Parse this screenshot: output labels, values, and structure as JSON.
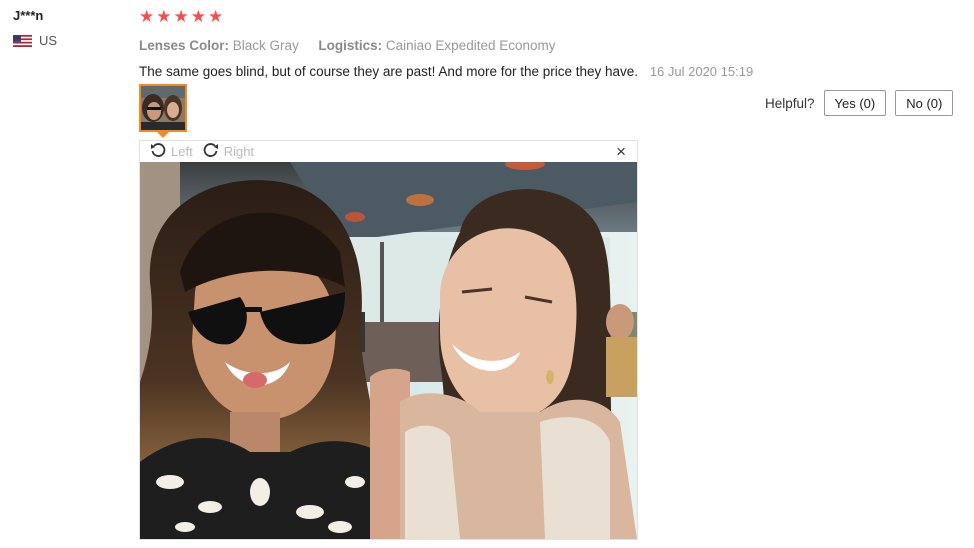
{
  "user": {
    "name": "J***n",
    "country": "US",
    "flag_icon": "us-flag-icon"
  },
  "review": {
    "rating": 5,
    "stars": [
      "★",
      "★",
      "★",
      "★",
      "★"
    ],
    "star_color": "#f44f4f",
    "attributes": [
      {
        "label": "Lenses Color:",
        "value": "Black Gray"
      },
      {
        "label": "Logistics:",
        "value": "Cainiao Expedited Economy"
      }
    ],
    "text": "The same goes blind, but of course they are past! And more for the price they have.",
    "date": "16 Jul 2020 15:19"
  },
  "helpful": {
    "label": "Helpful?",
    "yes_label": "Yes (0)",
    "no_label": "No (0)"
  },
  "viewer": {
    "left_label": "Left",
    "right_label": "Right",
    "close_glyph": "×",
    "accent_color": "#f08a24"
  }
}
